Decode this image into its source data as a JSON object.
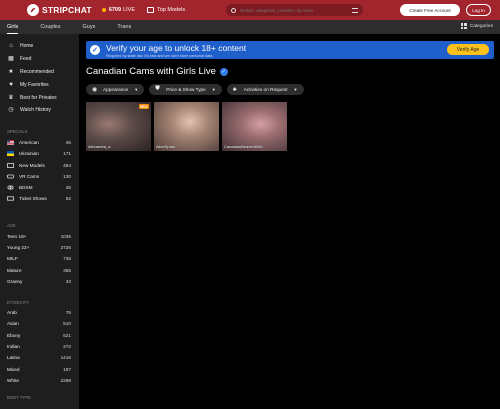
{
  "header": {
    "logo_text": "STRIPCHAT",
    "live_count": "6709",
    "live_label": "LIVE",
    "top_models_label": "Top Models",
    "search_placeholder": "Models, categories, countries, tip menu",
    "create_account_label": "Create Free Account",
    "login_label": "Log In"
  },
  "categories_bar": {
    "tabs": [
      "Girls",
      "Couples",
      "Guys",
      "Trans"
    ],
    "active_tab": "Girls",
    "categories_label": "Categories"
  },
  "sidebar": {
    "nav": [
      {
        "label": "Home",
        "icon": "home-icon"
      },
      {
        "label": "Feed",
        "icon": "feed-icon"
      },
      {
        "label": "Recommended",
        "icon": "star-icon"
      },
      {
        "label": "My Favorites",
        "icon": "heart-icon"
      },
      {
        "label": "Best for Privates",
        "icon": "crown-icon"
      },
      {
        "label": "Watch History",
        "icon": "history-icon"
      }
    ],
    "specials_title": "SPECIALS",
    "specials": [
      {
        "label": "American",
        "count": "46",
        "icon": "us-flag-icon"
      },
      {
        "label": "Ukrainian",
        "count": "171",
        "icon": "ua-flag-icon"
      },
      {
        "label": "New Models",
        "count": "494",
        "icon": "new-icon"
      },
      {
        "label": "VR Cams",
        "count": "130",
        "icon": "vr-icon"
      },
      {
        "label": "BDSM",
        "count": "45",
        "icon": "bdsm-icon"
      },
      {
        "label": "Ticket Shows",
        "count": "92",
        "icon": "ticket-icon"
      }
    ],
    "age_title": "AGE",
    "age": [
      {
        "label": "Teen 18+",
        "count": "1035"
      },
      {
        "label": "Young 22+",
        "count": "2726"
      },
      {
        "label": "MILF",
        "count": "736"
      },
      {
        "label": "Mature",
        "count": "355"
      },
      {
        "label": "Granny",
        "count": "43"
      }
    ],
    "ethnicity_title": "ETHNICITY",
    "ethnicity": [
      {
        "label": "Arab",
        "count": "76"
      },
      {
        "label": "Asian",
        "count": "510"
      },
      {
        "label": "Ebony",
        "count": "521"
      },
      {
        "label": "Indian",
        "count": "272"
      },
      {
        "label": "Latina",
        "count": "1416"
      },
      {
        "label": "Mixed",
        "count": "167"
      },
      {
        "label": "White",
        "count": "2298"
      }
    ],
    "body_type_title": "BODY TYPE"
  },
  "verify_banner": {
    "title": "Verify your age to unlock 18+ content",
    "subtitle": "Required by state law. It's fast and we don't store personal data.",
    "button_label": "Verify Age"
  },
  "page": {
    "title": "Canadian Cams with Girls Live"
  },
  "filters": [
    {
      "label": "Appearance",
      "icon": "eye-icon"
    },
    {
      "label": "Price & Show Type",
      "icon": "tag-icon"
    },
    {
      "label": "Activities on Request",
      "icon": "activities-icon"
    }
  ],
  "cards": [
    {
      "name": "Alexandra_a",
      "badge": "NEW"
    },
    {
      "name": "AliceSpark",
      "badge": ""
    },
    {
      "name": "CanadianBeaver5060",
      "badge": ""
    }
  ],
  "colors": {
    "header_bg": "#a2252d",
    "verify_bg": "#1f5fcc",
    "verify_button": "#ffc21a",
    "sidebar_bg": "#1e1e1e",
    "new_badge": "#ff8a00"
  }
}
